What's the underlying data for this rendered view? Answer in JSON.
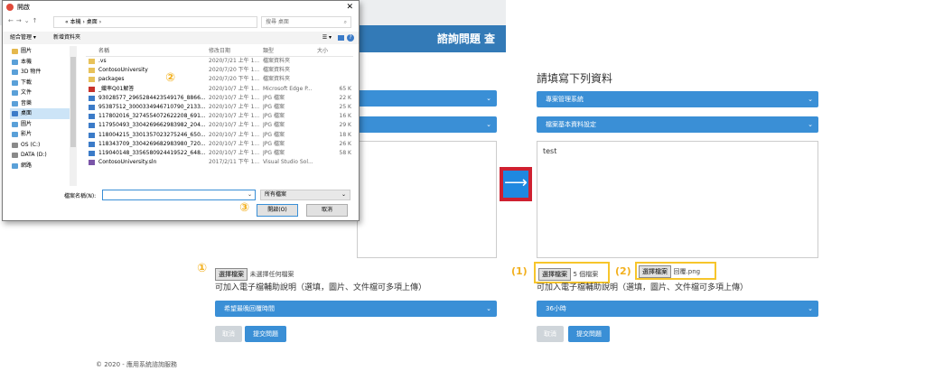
{
  "left_panel": {
    "banner_title": "諮詢問題 查",
    "footer": "© 2020 - 應用系統諮詢服務",
    "upload_button": "選擇檔案",
    "upload_status": "未選擇任何檔案",
    "upload_desc": "可加入電子檔輔助說明（選填，圖片、文件檔可多項上傳）",
    "reply_select": "希望最晚回覆時間",
    "cancel": "取消",
    "submit": "提交問題",
    "marker1": "①",
    "marker2": "②",
    "marker3": "③"
  },
  "dialog": {
    "title": "開啟",
    "close": "✕",
    "breadcrumb": "« 本機 › 桌面 ›",
    "search_placeholder": "搜尋 桌面",
    "organize": "組合管理 ▾",
    "new_folder": "新增資料夾",
    "nav_items": [
      {
        "label": "圖片",
        "color": "#e5b84d"
      },
      {
        "label": "本機",
        "color": "#5aa0d8"
      },
      {
        "label": "3D 物件",
        "color": "#5aa0d8"
      },
      {
        "label": "下載",
        "color": "#5aa0d8"
      },
      {
        "label": "文件",
        "color": "#5aa0d8"
      },
      {
        "label": "音樂",
        "color": "#5aa0d8"
      },
      {
        "label": "桌面",
        "color": "#3b7bc8"
      },
      {
        "label": "圖片",
        "color": "#5aa0d8"
      },
      {
        "label": "影片",
        "color": "#5aa0d8"
      },
      {
        "label": "OS (C:)",
        "color": "#8a8a8a"
      },
      {
        "label": "DATA (D:)",
        "color": "#8a8a8a"
      },
      {
        "label": "網路",
        "color": "#5aa0d8"
      }
    ],
    "headers": {
      "name": "名稱",
      "date": "修改日期",
      "type": "類型",
      "size": "大小"
    },
    "files": [
      {
        "name": ".vs",
        "date": "2020/7/21 上午 1...",
        "type": "檔案資料夾",
        "size": "",
        "color": "#e8c25a"
      },
      {
        "name": "ContosoUniversity",
        "date": "2020/7/20 下午 1...",
        "type": "檔案資料夾",
        "size": "",
        "color": "#e8c25a"
      },
      {
        "name": "packages",
        "date": "2020/7/20 下午 1...",
        "type": "檔案資料夾",
        "size": "",
        "color": "#e8c25a"
      },
      {
        "name": "_織率Q01解答",
        "date": "2020/10/7 上午 1...",
        "type": "Microsoft Edge P...",
        "size": "65 K",
        "color": "#c8322b"
      },
      {
        "name": "93028577_2965284423549176_8866...",
        "date": "2020/10/7 上午 1...",
        "type": "JPG 檔案",
        "size": "22 K",
        "color": "#3b7bc8"
      },
      {
        "name": "95387512_3000334946710790_2133...",
        "date": "2020/10/7 上午 1...",
        "type": "JPG 檔案",
        "size": "25 K",
        "color": "#3b7bc8"
      },
      {
        "name": "117802016_3274554072622208_691...",
        "date": "2020/10/7 上午 1...",
        "type": "JPG 檔案",
        "size": "16 K",
        "color": "#3b7bc8"
      },
      {
        "name": "117950493_3304269662983982_204...",
        "date": "2020/10/7 上午 1...",
        "type": "JPG 檔案",
        "size": "29 K",
        "color": "#3b7bc8"
      },
      {
        "name": "118004215_3301357023275246_650...",
        "date": "2020/10/7 上午 1...",
        "type": "JPG 檔案",
        "size": "18 K",
        "color": "#3b7bc8"
      },
      {
        "name": "118343709_3304269682983980_720...",
        "date": "2020/10/7 上午 1...",
        "type": "JPG 檔案",
        "size": "26 K",
        "color": "#3b7bc8"
      },
      {
        "name": "119040148_3356580924419522_648...",
        "date": "2020/10/7 上午 1...",
        "type": "JPG 檔案",
        "size": "58 K",
        "color": "#3b7bc8"
      },
      {
        "name": "ContosoUniversity.sln",
        "date": "2017/2/11 下午 1...",
        "type": "Visual Studio Sol...",
        "size": "",
        "color": "#7a55a8"
      }
    ],
    "filename_label": "檔案名稱(N):",
    "filetype": "所有檔案",
    "open": "開啟(O)",
    "cancel": "取消"
  },
  "right_panel": {
    "heading": "請填寫下列資料",
    "select1": "專案管理系統",
    "select2": "檔案基本資料設定",
    "textarea": "test",
    "marker1": "(1)",
    "marker2": "(2)",
    "file_btn": "選擇檔案",
    "file_count": "5 個檔案",
    "file_name": "回覆.png",
    "upload_desc": "可加入電子檔輔助說明（選填，圖片、文件檔可多項上傳）",
    "reply_select": "36小時",
    "cancel": "取消",
    "submit": "提交問題"
  },
  "arrow": "⟶"
}
